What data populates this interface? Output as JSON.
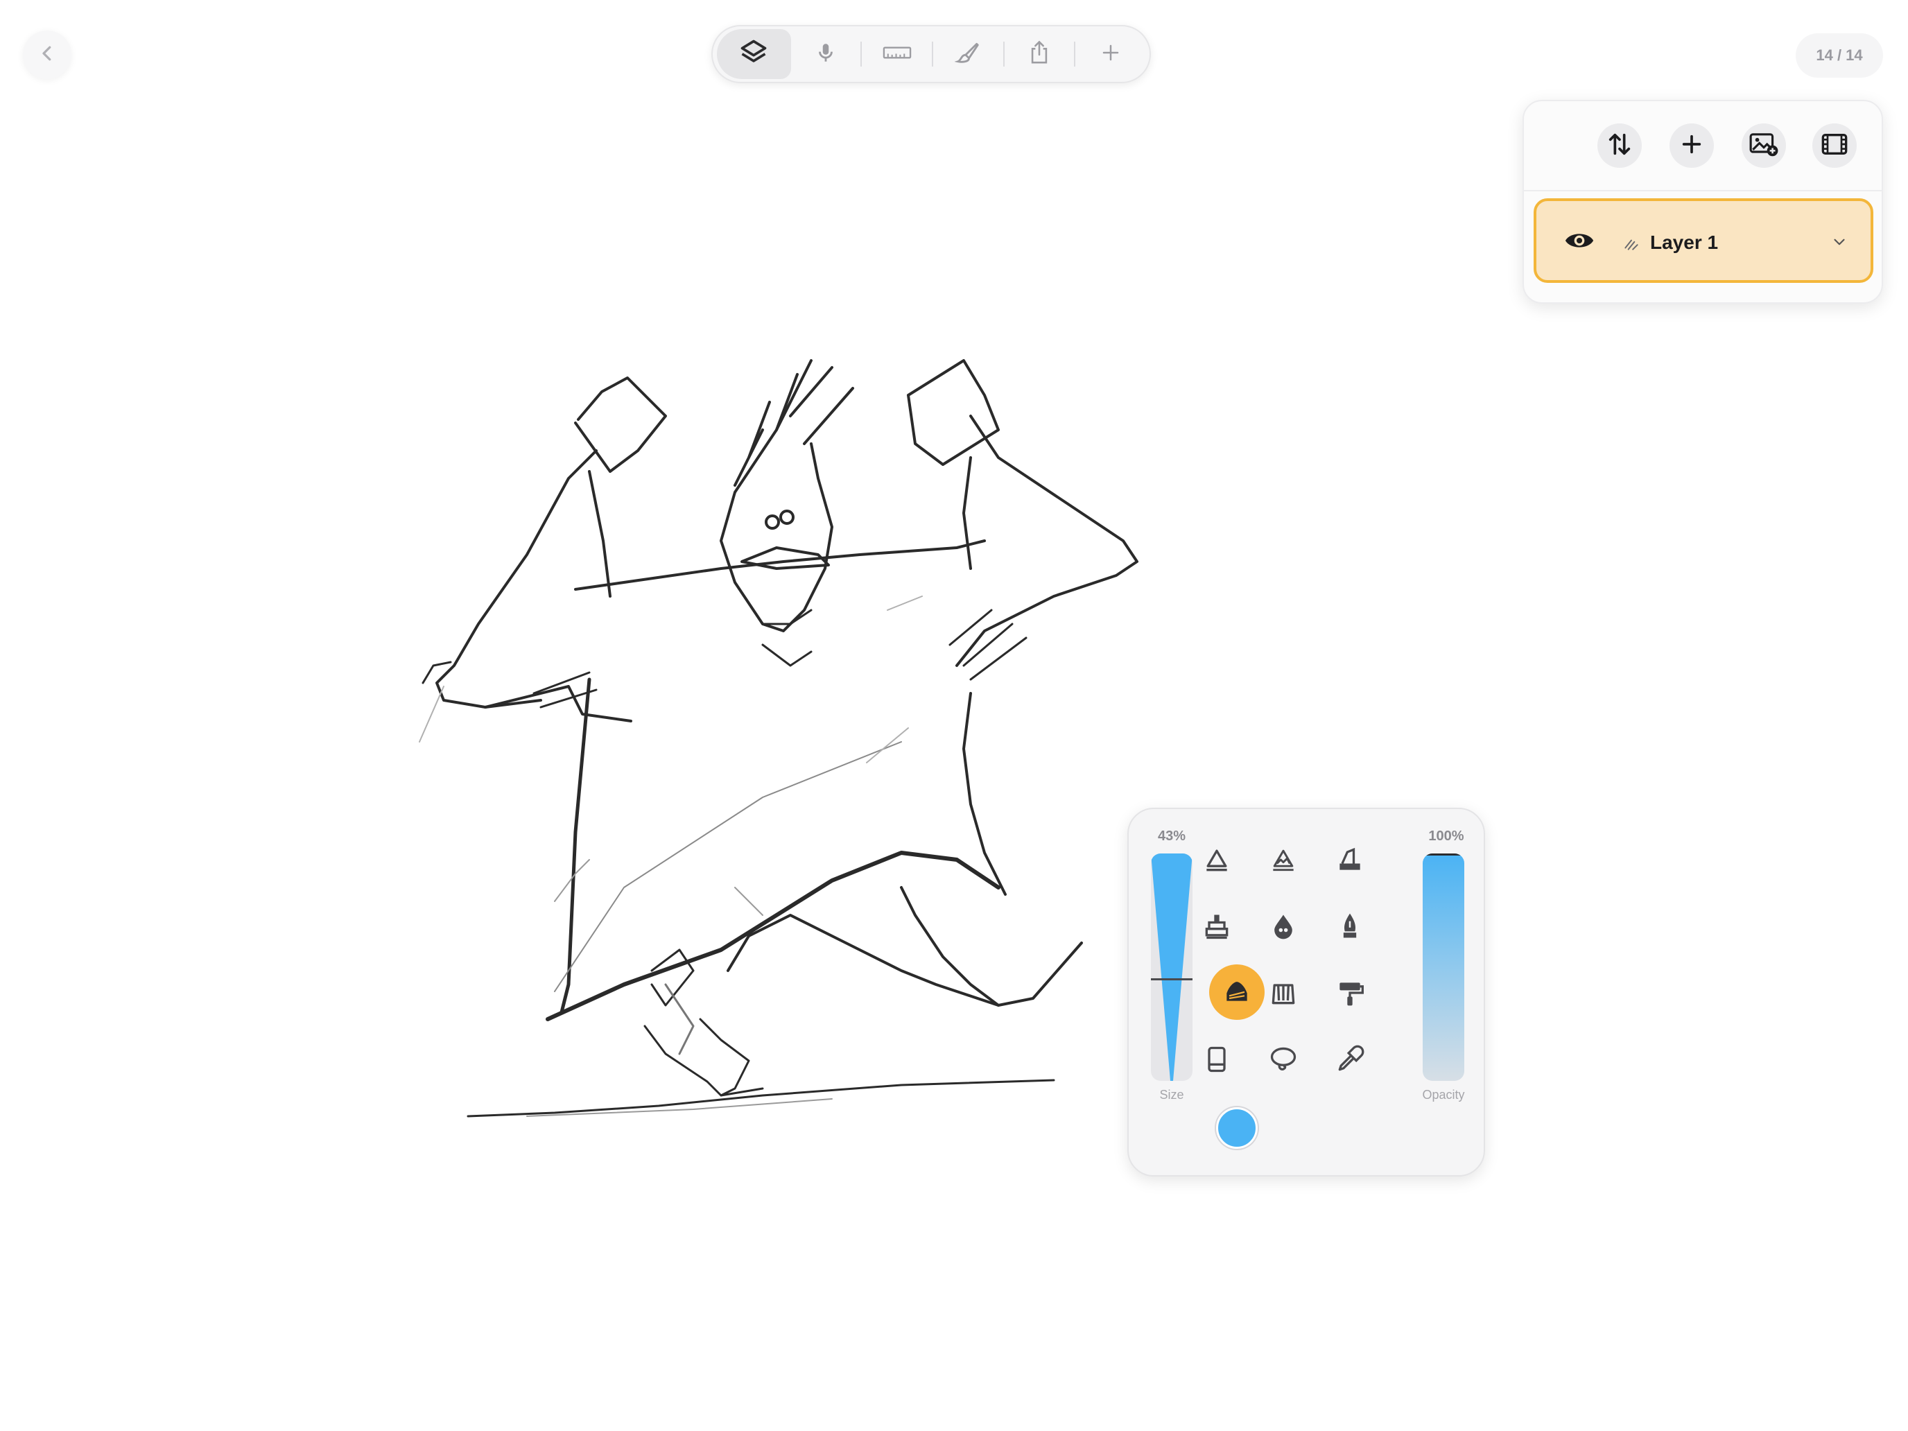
{
  "top_bar": {
    "back_icon": "chevron-left-icon",
    "page_counter": "14 / 14",
    "toolbar": [
      {
        "id": "layers",
        "icon": "layers-icon",
        "active": true
      },
      {
        "id": "record",
        "icon": "microphone-icon"
      },
      {
        "id": "ruler",
        "icon": "ruler-icon"
      },
      {
        "id": "brushes",
        "icon": "brush-icon"
      },
      {
        "id": "share",
        "icon": "share-icon"
      },
      {
        "id": "add",
        "icon": "plus-icon"
      }
    ]
  },
  "layers_panel": {
    "actions": [
      {
        "id": "reorder",
        "icon": "swap-vertical-icon"
      },
      {
        "id": "add-layer",
        "icon": "plus-icon"
      },
      {
        "id": "import-image",
        "icon": "image-add-icon"
      },
      {
        "id": "animation",
        "icon": "film-icon"
      }
    ],
    "layers": [
      {
        "name": "Layer 1",
        "visible": true,
        "selected": true
      }
    ]
  },
  "brush_panel": {
    "size_percent": "43%",
    "size_value": 0.43,
    "size_label": "Size",
    "opacity_percent": "100%",
    "opacity_value": 1.0,
    "opacity_label": "Opacity",
    "selected_brush": "charcoal",
    "color": "#4ab3f4",
    "brushes": [
      "pencil-icon",
      "textured-pencil-icon",
      "chisel-marker-icon",
      "stamp-marker-icon",
      "ink-drop-icon",
      "fountain-pen-icon",
      "charcoal-icon",
      "flat-brush-icon",
      "paint-roller-icon",
      "eraser-icon",
      "lasso-icon",
      "eyedropper-icon"
    ]
  },
  "colors": {
    "accent_orange": "#f7b13a",
    "layer_highlight": "#fae5c2",
    "slider_blue": "#4ab3f4"
  }
}
